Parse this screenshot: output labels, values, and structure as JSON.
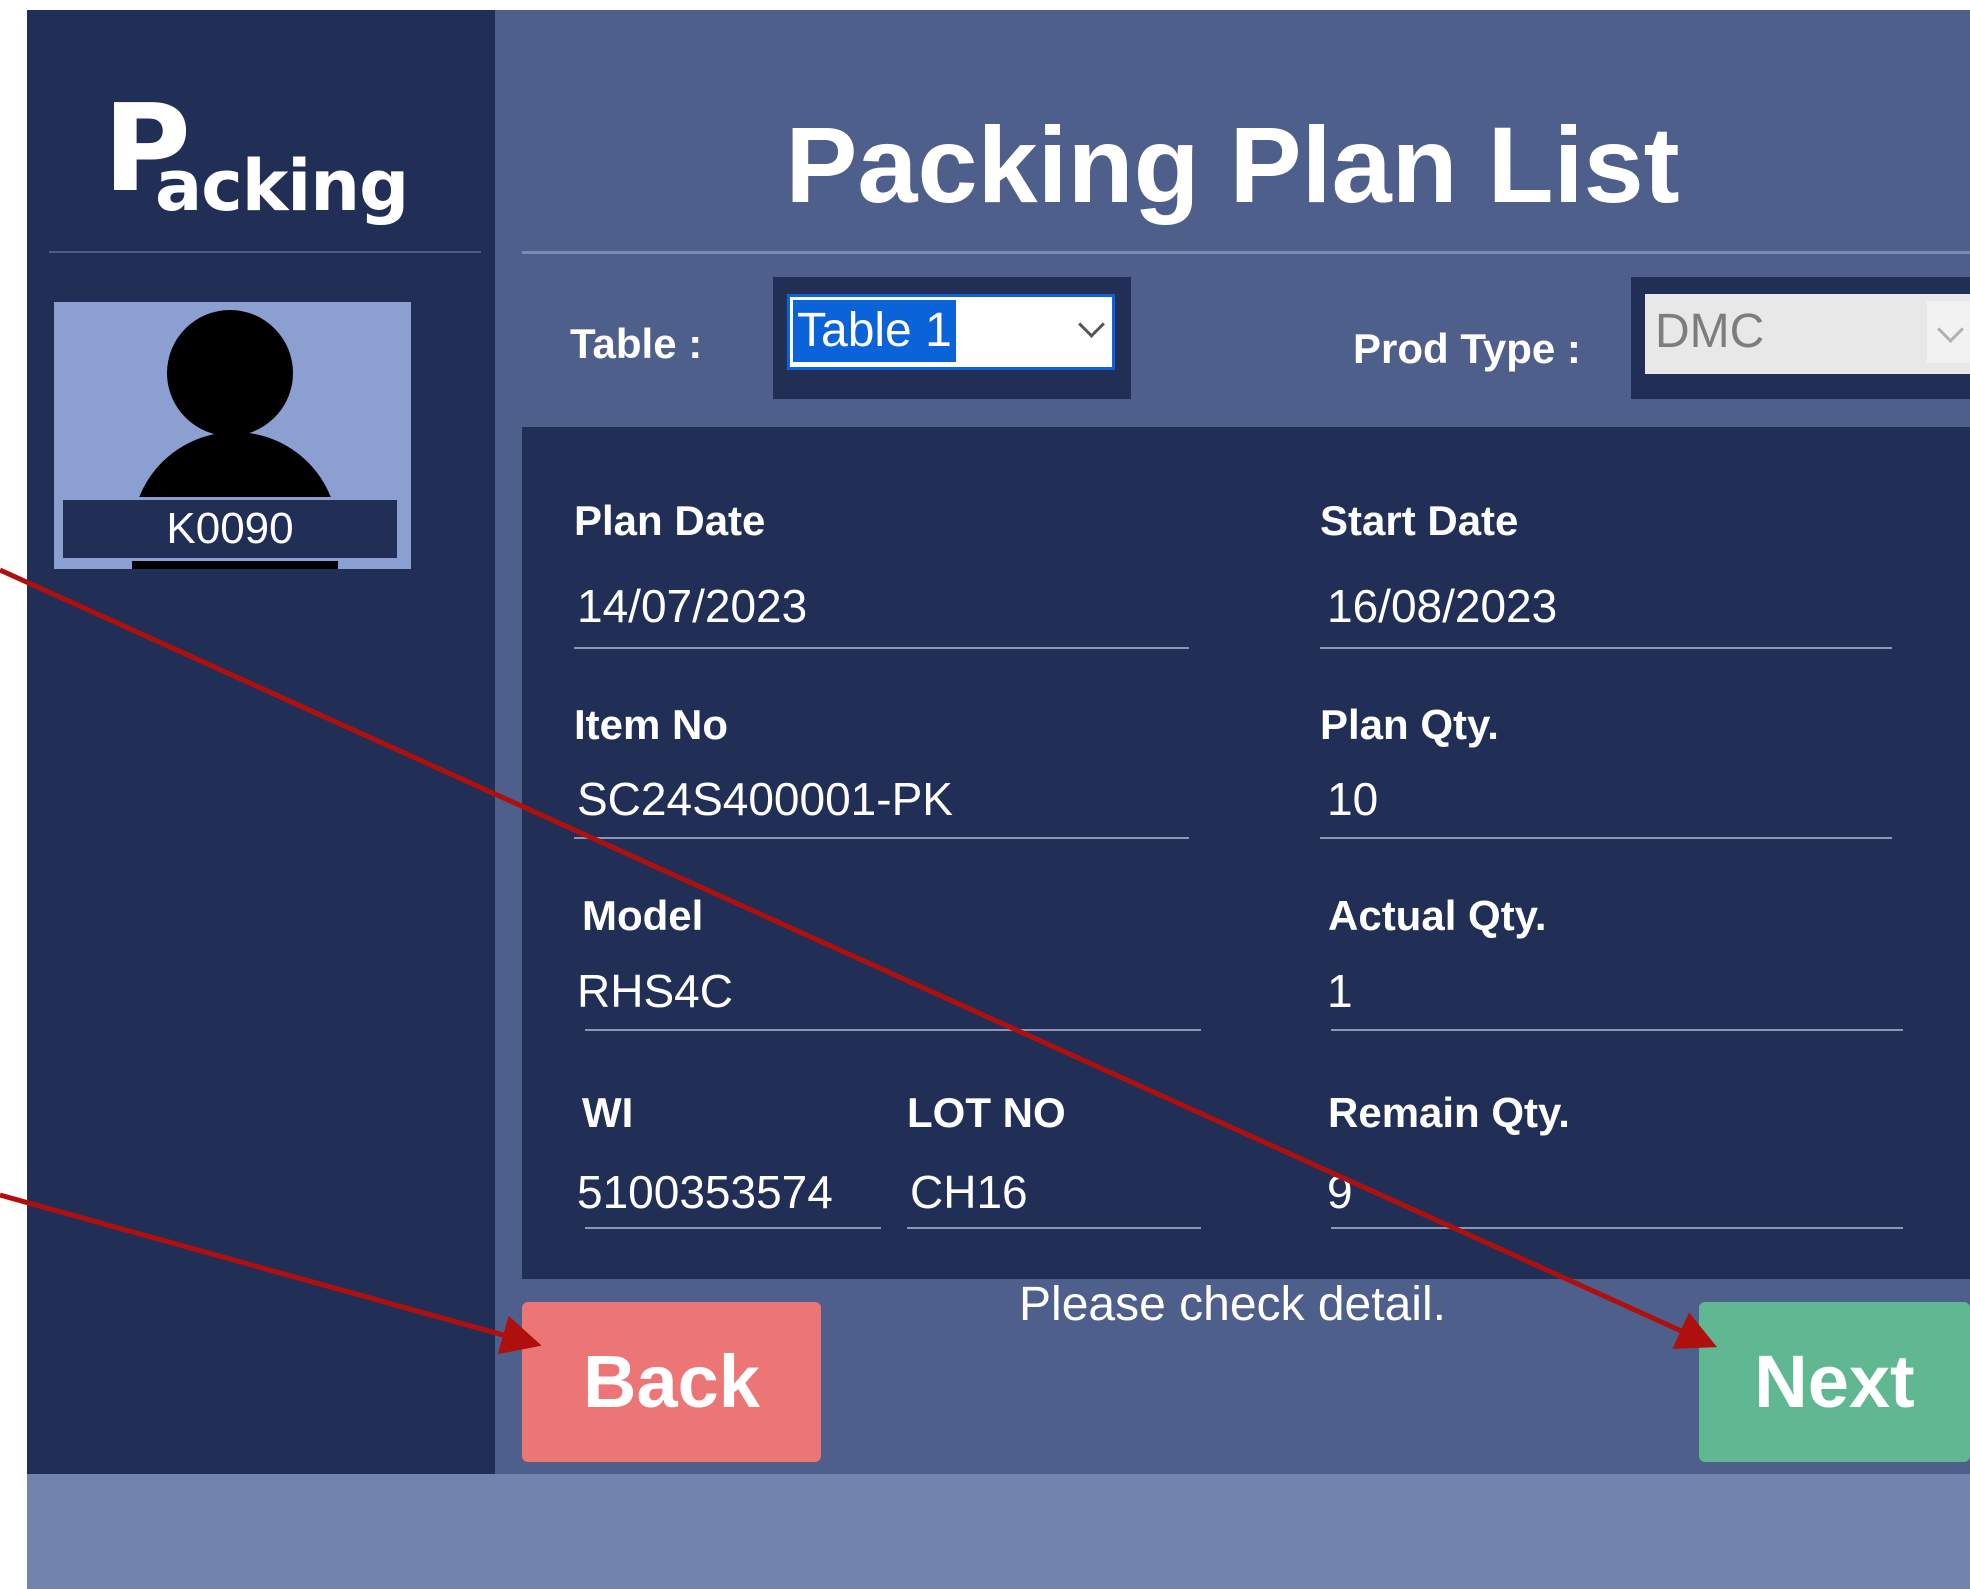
{
  "sidebar": {
    "logo": {
      "initial": "P",
      "rest": "acking"
    },
    "user": {
      "id": "K0090"
    }
  },
  "header": {
    "title": "Packing Plan List"
  },
  "filters": {
    "table": {
      "label": "Table :",
      "value": "Table 1"
    },
    "prod_type": {
      "label": "Prod Type :",
      "value": "DMC"
    }
  },
  "details": {
    "plan_date": {
      "label": "Plan Date",
      "value": "14/07/2023"
    },
    "start_date": {
      "label": "Start Date",
      "value": "16/08/2023"
    },
    "item_no": {
      "label": "Item No",
      "value": "SC24S400001-PK"
    },
    "plan_qty": {
      "label": "Plan Qty.",
      "value": "10"
    },
    "model": {
      "label": "Model",
      "value": "RHS4C"
    },
    "actual_qty": {
      "label": "Actual Qty.",
      "value": "1"
    },
    "wi": {
      "label": "WI",
      "value": "5100353574"
    },
    "lot_no": {
      "label": "LOT NO",
      "value": "CH16"
    },
    "remain_qty": {
      "label": "Remain Qty.",
      "value": "9"
    }
  },
  "status_message": "Please check detail.",
  "buttons": {
    "back": "Back",
    "next": "Next"
  },
  "colors": {
    "sidebar_bg": "#212f57",
    "main_bg": "#4f5f8c",
    "panel_bg": "#212f57",
    "footer_bg": "#7284ad",
    "back_button": "#ec7676",
    "next_button": "#60b893",
    "annotation_arrow": "#b0100d",
    "selection_highlight": "#0a63d8"
  }
}
